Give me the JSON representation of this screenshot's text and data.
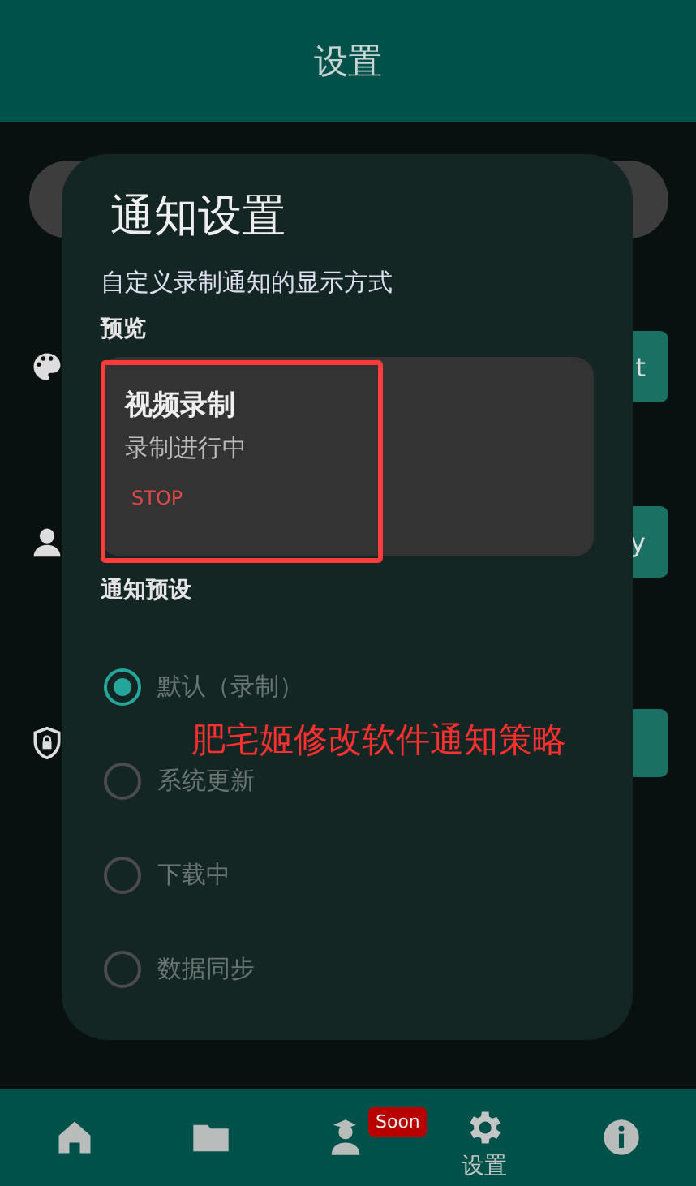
{
  "app_bar": {
    "title": "设置"
  },
  "background_buttons": [
    "t",
    "y"
  ],
  "dialog": {
    "title": "通知设置",
    "subtitle": "自定义录制通知的显示方式",
    "preview_label": "预览",
    "preview": {
      "title": "视频录制",
      "text": "录制进行中",
      "action": "STOP"
    },
    "presets_label": "通知预设",
    "presets": [
      {
        "label": "默认（录制）",
        "selected": true
      },
      {
        "label": "系统更新",
        "selected": false
      },
      {
        "label": "下载中",
        "selected": false
      },
      {
        "label": "数据同步",
        "selected": false
      }
    ],
    "annotation": "肥宅姬修改软件通知策略"
  },
  "nav": [
    {
      "kind": "home",
      "selected": false
    },
    {
      "kind": "folder",
      "selected": false
    },
    {
      "kind": "profile",
      "selected": false,
      "badge": "Soon"
    },
    {
      "kind": "settings",
      "selected": true,
      "label": "设置"
    },
    {
      "kind": "info",
      "selected": false
    }
  ]
}
